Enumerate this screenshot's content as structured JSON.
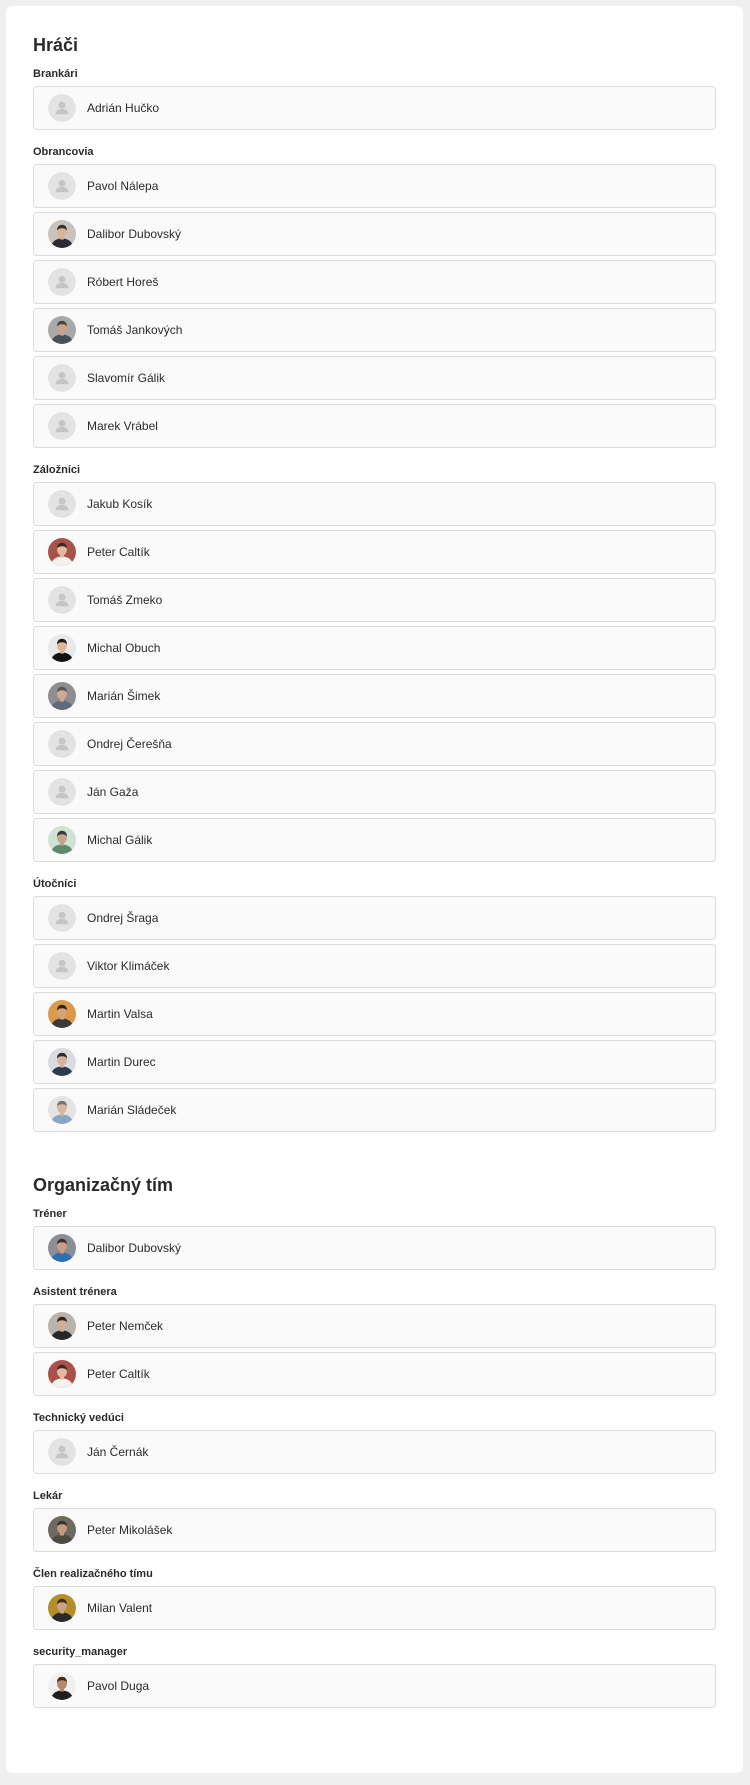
{
  "sections": [
    {
      "title": "Hráči",
      "groups": [
        {
          "title": "Brankári",
          "people": [
            {
              "name": "Adrián Hučko",
              "photo": false
            }
          ]
        },
        {
          "title": "Obrancovia",
          "people": [
            {
              "name": "Pavol Nálepa",
              "photo": false
            },
            {
              "name": "Dalibor Dubovský",
              "photo": true,
              "bg": "#c9c3bd",
              "skin": "#d7b49b",
              "hair": "#3a2f28",
              "shirt": "#2e2a33"
            },
            {
              "name": "Róbert Horeš",
              "photo": false
            },
            {
              "name": "Tomáš Jankových",
              "photo": true,
              "bg": "#a9a9a9",
              "skin": "#c8a48e",
              "hair": "#4a4340",
              "shirt": "#4b5058"
            },
            {
              "name": "Slavomír Gálik",
              "photo": false
            },
            {
              "name": "Marek Vrábel",
              "photo": false
            }
          ]
        },
        {
          "title": "Záložníci",
          "people": [
            {
              "name": "Jakub Kosík",
              "photo": false
            },
            {
              "name": "Peter Caltík",
              "photo": true,
              "bg": "#a9524a",
              "skin": "#e2b8a0",
              "hair": "#3b2a22",
              "shirt": "#f3f1ee"
            },
            {
              "name": "Tomáš Zmeko",
              "photo": false
            },
            {
              "name": "Michal Obuch",
              "photo": true,
              "bg": "#e9e9e9",
              "skin": "#d9b59a",
              "hair": "#1e1b19",
              "shirt": "#121212"
            },
            {
              "name": "Marián Šimek",
              "photo": true,
              "bg": "#8e8e92",
              "skin": "#cfa891",
              "hair": "#5a5552",
              "shirt": "#5e6b7f"
            },
            {
              "name": "Ondrej Čerešňa",
              "photo": false
            },
            {
              "name": "Ján Gaža",
              "photo": false
            },
            {
              "name": "Michal Gálik",
              "photo": true,
              "bg": "#cfe3d4",
              "skin": "#c3a48d",
              "hair": "#3a3a3a",
              "shirt": "#5c8a6a"
            }
          ]
        },
        {
          "title": "Útočníci",
          "people": [
            {
              "name": "Ondrej Šraga",
              "photo": false
            },
            {
              "name": "Viktor Klimáček",
              "photo": false
            },
            {
              "name": "Martin Valsa",
              "photo": true,
              "bg": "#d99a4b",
              "skin": "#d4a27d",
              "hair": "#2e231b",
              "shirt": "#3b3b3b"
            },
            {
              "name": "Martin Durec",
              "photo": true,
              "bg": "#d9dbdf",
              "skin": "#d6b39c",
              "hair": "#2f2a27",
              "shirt": "#2b3a4d"
            },
            {
              "name": "Marián Sládeček",
              "photo": true,
              "bg": "#e4e4e4",
              "skin": "#d8b7a1",
              "hair": "#7a746f",
              "shirt": "#8aa6c4"
            }
          ]
        }
      ]
    },
    {
      "title": "Organizačný tím",
      "groups": [
        {
          "title": "Tréner",
          "people": [
            {
              "name": "Dalibor Dubovský",
              "photo": true,
              "bg": "#8b8f95",
              "skin": "#c89f86",
              "hair": "#3a3330",
              "shirt": "#2f6fb3"
            }
          ]
        },
        {
          "title": "Asistent trénera",
          "people": [
            {
              "name": "Peter Nemček",
              "photo": true,
              "bg": "#b9b3ac",
              "skin": "#d2ae96",
              "hair": "#2b2522",
              "shirt": "#262626"
            },
            {
              "name": "Peter Caltík",
              "photo": true,
              "bg": "#a9524a",
              "skin": "#e2b8a0",
              "hair": "#3b2a22",
              "shirt": "#f3f1ee"
            }
          ]
        },
        {
          "title": "Technický vedúci",
          "people": [
            {
              "name": "Ján Černák",
              "photo": false
            }
          ]
        },
        {
          "title": "Lekár",
          "people": [
            {
              "name": "Peter Mikolášek",
              "photo": true,
              "bg": "#6f6a5f",
              "skin": "#c49a80",
              "hair": "#3c3228",
              "shirt": "#4d4a44"
            }
          ]
        },
        {
          "title": "Člen realizačného tímu",
          "people": [
            {
              "name": "Milan Valent",
              "photo": true,
              "bg": "#b58e2a",
              "skin": "#cda283",
              "hair": "#3a2f22",
              "shirt": "#2a2a2a"
            }
          ]
        },
        {
          "title": "security_manager",
          "people": [
            {
              "name": "Pavol Duga",
              "photo": true,
              "bg": "#f0f0f0",
              "skin": "#b9876c",
              "hair": "#3a2a22",
              "shirt": "#1e1e1e"
            }
          ]
        }
      ]
    }
  ]
}
